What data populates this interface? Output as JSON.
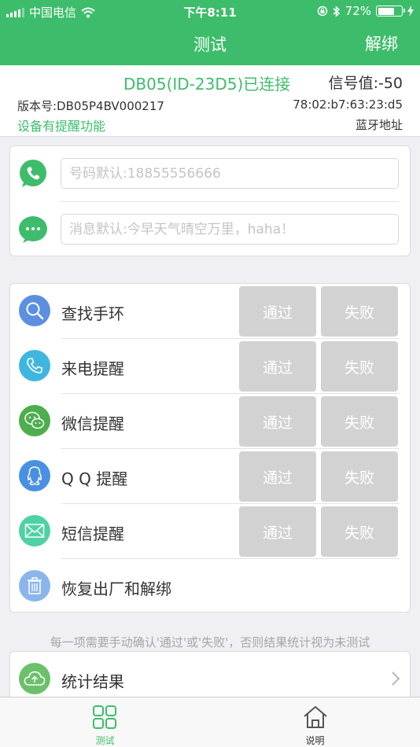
{
  "status_bar": {
    "carrier": "中国电信",
    "time": "下午8:11",
    "battery": "72%",
    "battery_level": 0.72
  },
  "nav": {
    "title": "测试",
    "right_action": "解绑"
  },
  "device": {
    "connection": "DB05(ID-23D5)已连接",
    "signal": "信号值:-50",
    "firmware": "版本号:DB05P4BV000217",
    "mac": "78:02:b7:63:23:d5",
    "reminder_feature": "设备有提醒功能",
    "bt_address_label": "蓝牙地址"
  },
  "inputs": {
    "phone_placeholder": "号码默认:18855556666",
    "message_placeholder": "消息默认:今早天气晴空万里，haha！"
  },
  "tests": {
    "pass_label": "通过",
    "fail_label": "失败",
    "items": [
      {
        "label": "查找手环",
        "icon": "search-icon",
        "color": "#5d8fe0"
      },
      {
        "label": "来电提醒",
        "icon": "phone-icon",
        "color": "#3fb6e0"
      },
      {
        "label": "微信提醒",
        "icon": "wechat-icon",
        "color": "#4cae4c"
      },
      {
        "label": "Q Q 提醒",
        "icon": "qq-icon",
        "color": "#4a90e2"
      },
      {
        "label": "短信提醒",
        "icon": "envelope-icon",
        "color": "#4fd1a5"
      },
      {
        "label": "恢复出厂和解绑",
        "icon": "trash-icon",
        "color": "#8ab6ec"
      }
    ]
  },
  "note": "每一项需要手动确认'通过'或'失败'，否则结果统计视为未测试",
  "stats": {
    "label": "统计结果",
    "icon": "upload-cloud-icon",
    "color": "#6cc06c"
  },
  "tabbar": {
    "tab1": "测试",
    "tab2": "说明"
  },
  "colors": {
    "primary": "#3dbd6b",
    "button_gray": "#d2d2d2"
  }
}
